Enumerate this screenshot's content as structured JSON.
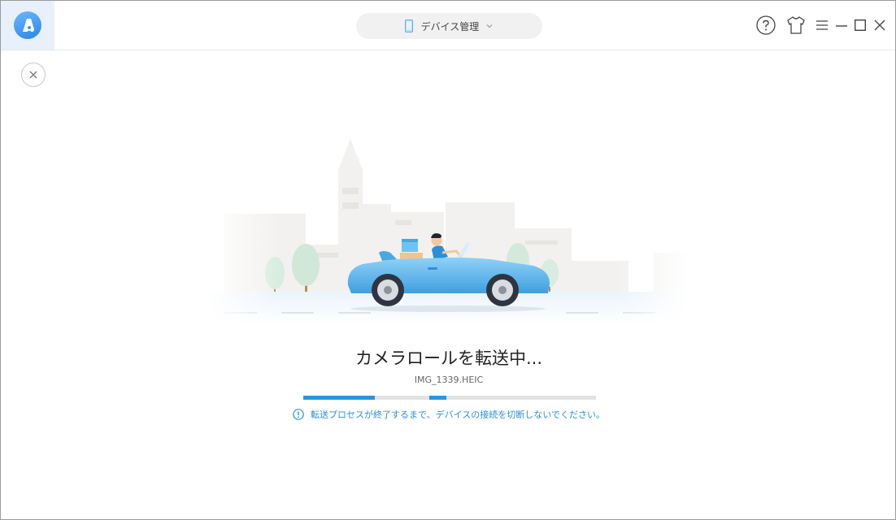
{
  "header": {
    "device_selector_label": "デバイス管理",
    "icons": [
      "app-logo-icon",
      "phone-icon",
      "chevron-down-icon",
      "help-icon",
      "skin-shirt-icon",
      "menu-icon",
      "minimize-icon",
      "maximize-icon",
      "close-icon"
    ]
  },
  "transfer": {
    "title": "カメラロールを転送中...",
    "current_file": "IMG_1339.HEIC",
    "progress_segments": [
      {
        "start": 0.0,
        "end": 0.245
      },
      {
        "start": 0.43,
        "end": 0.49
      }
    ],
    "notice": "転送プロセスが終了するまで、デバイスの接続を切断しないでください。"
  },
  "colors": {
    "accent": "#2a96e2",
    "notice_text": "#2a8fd6",
    "car_body": "#5bb4ec"
  }
}
